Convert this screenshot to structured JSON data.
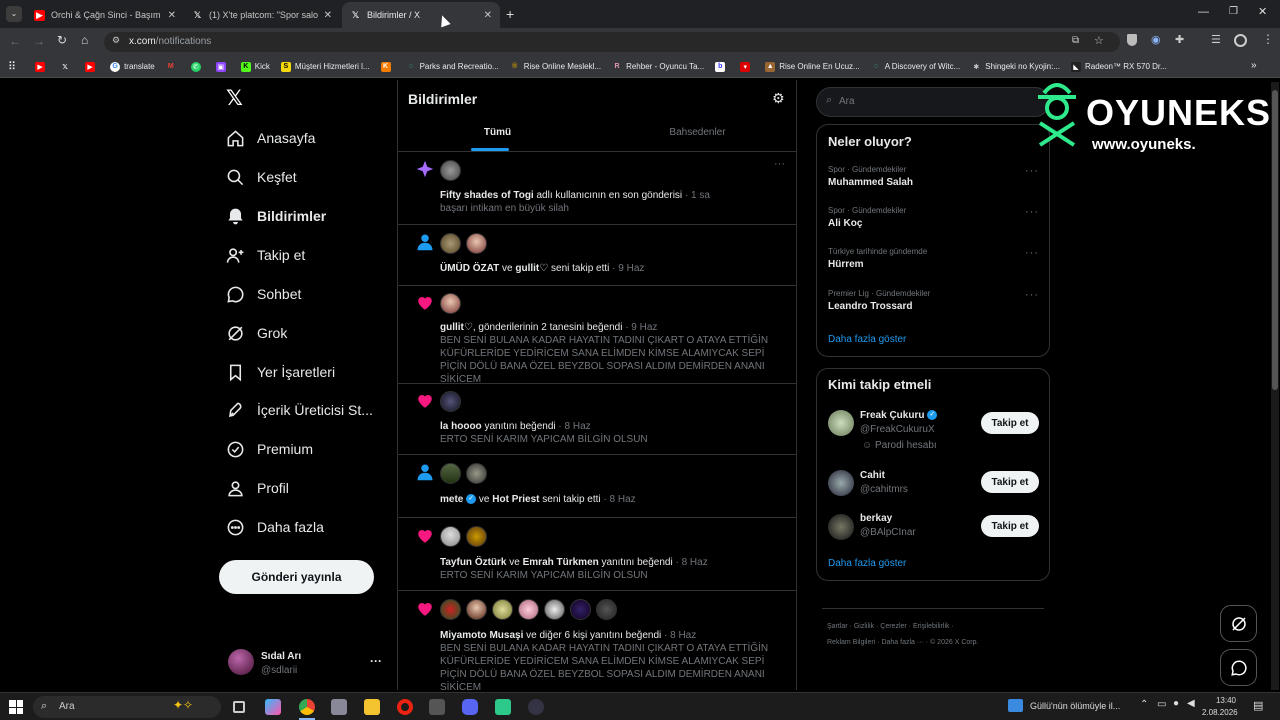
{
  "browser": {
    "tabs": [
      {
        "title": "Orchi & Çağn Sinci - Başım Belı",
        "active": false
      },
      {
        "title": "(1) X'te platcom: \"Spor salonun",
        "active": false
      },
      {
        "title": "Bildirimler / X",
        "active": true
      }
    ],
    "url_host": "x.com",
    "url_path": "/notifications",
    "bookmarks": [
      "translate",
      "Kick",
      "Müşteri Hizmetleri l...",
      "Parks and Recreatio...",
      "Rise Online Meslekl...",
      "Rehber - Oyuncu Ta...",
      "Rise Online En Ucuz...",
      "A Discovery of Witc...",
      "Shingeki no Kyojin:...",
      "Radeon™ RX 570 Dr..."
    ]
  },
  "nav": {
    "items": [
      "Anasayfa",
      "Keşfet",
      "Bildirimler",
      "Takip et",
      "Sohbet",
      "Grok",
      "Yer İşaretleri",
      "İçerik Üreticisi St...",
      "Premium",
      "Profil",
      "Daha fazla"
    ],
    "post_button": "Gönderi yayınla",
    "user_name": "Sıdal Arı",
    "user_handle": "@sdlarii",
    "more": "···"
  },
  "main": {
    "title": "Bildirimler",
    "tabs": [
      "Tümü",
      "Bahsedenler"
    ],
    "notifications": [
      {
        "type": "star",
        "actor": "Fifty shades of Togi",
        "text": " adlı kullanıcının en son gönderisi",
        "time": "· 1 sa",
        "sub": "başarı intikam en büyük silah"
      },
      {
        "type": "follow",
        "actor": "ÜMÜD ÖZAT",
        "joiner": " ve ",
        "actor2": "gullit♡",
        "text": " seni takip etti",
        "time": "· 9 Haz",
        "sub": ""
      },
      {
        "type": "like",
        "actor": "gullit♡",
        "text": ", gönderilerinin 2 tanesini beğendi",
        "time": "· 9 Haz",
        "sub": "BEN SENİ BULANA KADAR HAYATIN TADINI ÇIKART O ATAYA ETTİĞİN KÜFÜRLERİDE YEDİRİCEM SANA ELİMDEN KİMSE ALAMIYCAK SEPİ PİÇİN DÖLÜ BANA ÖZEL BEYZBOL SOPASI ALDIM DEMİRDEN ANANI SİKİCEM"
      },
      {
        "type": "like",
        "actor": "la hoooo",
        "text": " yanıtını beğendi",
        "time": "· 8 Haz",
        "sub": "ERTO SENİ KARIM YAPICAM BİLGİN OLSUN"
      },
      {
        "type": "follow",
        "actor": "mete",
        "joiner": " ve ",
        "actor2": "Hot Priest",
        "text": " seni takip etti",
        "time": "· 8 Haz",
        "sub": ""
      },
      {
        "type": "like",
        "actor": "Tayfun Öztürk",
        "joiner": " ve ",
        "actor2": "Emrah Türkmen",
        "text": " yanıtını beğendi",
        "time": "· 8 Haz",
        "sub": "ERTO SENİ KARIM YAPICAM BİLGİN OLSUN"
      },
      {
        "type": "like",
        "actor": "Miyamoto Musaşi",
        "text": " ve diğer 6 kişi yanıtını beğendi",
        "time": "· 8 Haz",
        "sub": "BEN SENİ BULANA KADAR HAYATIN TADINI ÇIKART O ATAYA ETTİĞİN KÜFÜRLERİDE YEDİRİCEM SANA ELİMDEN KİMSE ALAMIYCAK SEPİ PİÇİN DÖLÜ BANA ÖZEL BEYZBOL SOPASI ALDIM DEMİRDEN ANANI SİKİCEM"
      }
    ]
  },
  "sidebar": {
    "search_placeholder": "Ara",
    "trends_title": "Neler oluyor?",
    "trends": [
      {
        "category": "Spor · Gündemdekiler",
        "name": "Muhammed Salah"
      },
      {
        "category": "Spor · Gündemdekiler",
        "name": "Ali Koç"
      },
      {
        "category": "Türkiye tarihinde gündemde",
        "name": "Hürrem"
      },
      {
        "category": "Premier Lig · Gündemdekiler",
        "name": "Leandro Trossard"
      }
    ],
    "show_more": "Daha fazla göster",
    "follow_title": "Kimi takip etmeli",
    "follow_suggestions": [
      {
        "name": "Freak Çukuru",
        "handle": "@FreakCukuruX",
        "note": "Parodi hesabı",
        "button": "Takip et"
      },
      {
        "name": "Cahit",
        "handle": "@cahitmrs",
        "note": "",
        "button": "Takip et"
      },
      {
        "name": "berkay",
        "handle": "@BAlpCInar",
        "note": "",
        "button": "Takip et"
      }
    ],
    "footer_line1": "Şartlar · Gizlilik · Çerezler · Erişilebilirlik ·",
    "footer_line2": "Reklam Bilgileri · Daha fazla ··· · © 2026 X Corp."
  },
  "watermark": {
    "brand": "OYUNEKS",
    "url": "www.oyuneks."
  },
  "taskbar": {
    "search": "Ara",
    "news": "Güllü'nün ölümüyle il...",
    "time": "13:40",
    "date": "2.08.2026"
  },
  "colors": {
    "accent": "#1d9bf0",
    "like": "#f91880",
    "star": "#a66bff"
  }
}
